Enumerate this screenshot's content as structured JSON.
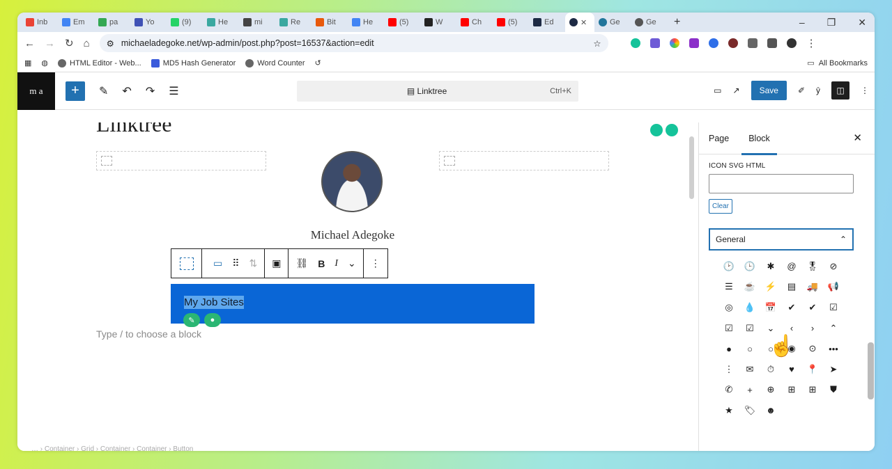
{
  "browser": {
    "tabs": [
      {
        "label": "Inb",
        "color": "#ea4335"
      },
      {
        "label": "Em",
        "color": "#4285f4"
      },
      {
        "label": "pa",
        "color": "#34a853"
      },
      {
        "label": "Yo",
        "color": "#3f51b5"
      },
      {
        "label": "(9)",
        "color": "#25d366"
      },
      {
        "label": "He",
        "color": "#3aa8a0"
      },
      {
        "label": "mi",
        "color": "#444444"
      },
      {
        "label": "Re",
        "color": "#3aa8a0"
      },
      {
        "label": "Bit",
        "color": "#e8590c"
      },
      {
        "label": "He",
        "color": "#4285f4"
      },
      {
        "label": "(5)",
        "color": "#ff0000"
      },
      {
        "label": "W",
        "color": "#222222"
      },
      {
        "label": "Ch",
        "color": "#ff0000"
      },
      {
        "label": "(5)",
        "color": "#ff0000"
      },
      {
        "label": "Ed",
        "color": "#1d2a44"
      },
      {
        "label": "",
        "color": "#1d2a44"
      },
      {
        "label": "Ge",
        "color": "#21759b"
      },
      {
        "label": "Ge",
        "color": "#555555"
      }
    ],
    "url": "michaeladegoke.net/wp-admin/post.php?post=16537&action=edit",
    "bookmarks": [
      {
        "label": "HTML Editor - Web..."
      },
      {
        "label": "MD5 Hash Generator"
      },
      {
        "label": "Word Counter"
      }
    ],
    "all_bookmarks": "All Bookmarks"
  },
  "wp": {
    "logo": "m a",
    "doc_title": "Linktree",
    "shortcut": "Ctrl+K",
    "save": "Save"
  },
  "canvas": {
    "page_title": "Linktree",
    "name": "Michael Adegoke",
    "button_text": "My Job Sites",
    "placeholder": "Type / to choose a block",
    "breadcrumb": "… › Container › Grid › Container › Container › Button"
  },
  "sidebar": {
    "tabs": [
      "Page",
      "Block"
    ],
    "svg_label": "ICON SVG HTML",
    "clear": "Clear",
    "section": "General",
    "icons": [
      "🕑",
      "🕒",
      "✱",
      "@",
      "🎖",
      "⊘",
      "☰",
      "☕",
      "⚡",
      "▤",
      "🚚",
      "📢",
      "◎",
      "💧",
      "📅",
      "✔",
      "✔",
      "☑",
      "☑",
      "☑",
      "⌄",
      "‹",
      "›",
      "⌃",
      "●",
      "○",
      "○",
      "◉",
      "⊙",
      "•••",
      "⋮",
      "✉",
      "⏱",
      "♥",
      "📍",
      "➤",
      "✆",
      "+",
      "⊕",
      "⊞",
      "⊞",
      "⛊",
      "★",
      "🏷",
      "☻"
    ]
  }
}
